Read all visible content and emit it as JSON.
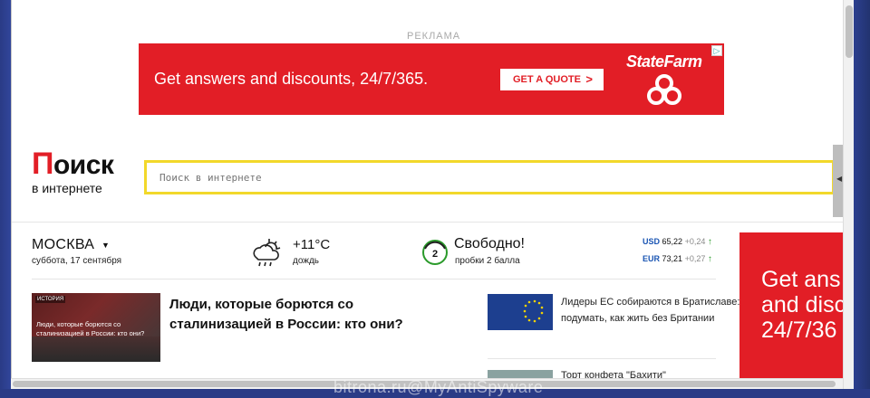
{
  "ad": {
    "label": "РЕКЛАМА",
    "text": "Get answers and discounts, 24/7/365.",
    "button_label": "GET A QUOTE",
    "brand": "StateFarm",
    "brand_color": "#e21e26"
  },
  "logo": {
    "first_letter": "П",
    "rest": "оиск",
    "subtitle": "в интернете"
  },
  "search": {
    "placeholder": "Поиск в интернете"
  },
  "city": {
    "name": "МОСКВА",
    "date": "суббота, 17 сентября"
  },
  "weather": {
    "temperature": "+11°С",
    "description": "дождь",
    "icon": "cloud-rain-sun-icon"
  },
  "traffic": {
    "level": "2",
    "status": "Свободно!",
    "description": "пробки 2 балла"
  },
  "currency": [
    {
      "code": "USD",
      "value": "65,22",
      "change": "+0,24",
      "trend": "up"
    },
    {
      "code": "EUR",
      "value": "73,21",
      "change": "+0,27",
      "trend": "up"
    }
  ],
  "promo": {
    "lines": [
      "Get ans",
      "and disc",
      "24/7/36"
    ]
  },
  "news": {
    "main": {
      "tag": "ИСТОРИЯ",
      "image_caption": "Люди, которые борются со сталинизацией в России: кто они?",
      "title": "Люди, которые борются со сталинизацией в России: кто они?"
    },
    "items": [
      {
        "text": "Лидеры ЕС собираются в Братиславе: подумать, как жить без Британии"
      },
      {
        "text": "Торт конфета \"Бахити\""
      }
    ]
  },
  "watermark": "bitrona.ru@MyAntiSpyware"
}
